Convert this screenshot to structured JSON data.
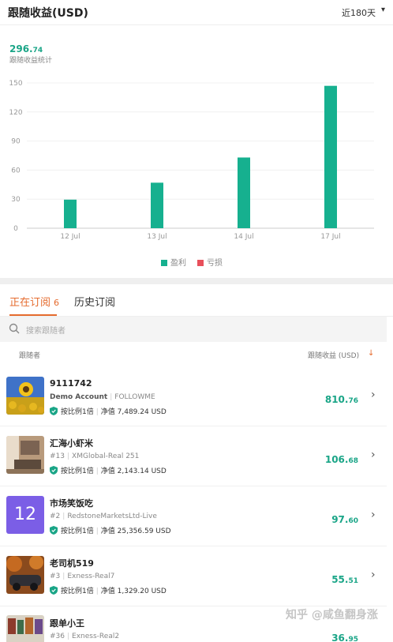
{
  "header": {
    "title": "跟随收益(USD)",
    "range": "近180天",
    "range_arrow": "▾"
  },
  "summary": {
    "total_int": "296.",
    "total_dec": "74",
    "label": "跟随收益统计"
  },
  "chart_data": {
    "type": "bar",
    "categories": [
      "12 Jul",
      "13 Jul",
      "14 Jul",
      "17 Jul"
    ],
    "series": [
      {
        "name": "盈利",
        "values": [
          29.5,
          47,
          73,
          147
        ],
        "color": "#16b08f"
      },
      {
        "name": "亏损",
        "values": [
          0,
          0,
          0,
          0
        ],
        "color": "#e8505b"
      }
    ],
    "yticks": [
      0,
      30,
      60,
      90,
      120,
      150
    ],
    "ylim": [
      0,
      150
    ],
    "grid": true,
    "legend_position": "bottom"
  },
  "tabs": [
    {
      "label": "正在订阅",
      "count": "6"
    },
    {
      "label": "历史订阅"
    }
  ],
  "search": {
    "placeholder": "搜索跟随者"
  },
  "columns": {
    "follower": "跟随者",
    "profit": "跟随收益 (USD)",
    "sort_icon": "↓"
  },
  "followers": [
    {
      "name": "9111742",
      "account": "Demo Account",
      "broker": "FOLLOWME",
      "ratio": "按比例1倍",
      "equity": "净值 7,489.24 USD",
      "profit_int": "810.",
      "profit_dec": "76",
      "avatar": "sunflower-photo"
    },
    {
      "name": "汇海小虾米",
      "account": "#13",
      "broker": "XMGlobal-Real 251",
      "ratio": "按比例1倍",
      "equity": "净值 2,143.14 USD",
      "profit_int": "106.",
      "profit_dec": "68",
      "avatar": "room-photo"
    },
    {
      "name": "市场笑饭吃",
      "account": "#2",
      "broker": "RedstoneMarketsLtd-Live",
      "ratio": "按比例1倍",
      "equity": "净值 25,356.59 USD",
      "profit_int": "97.",
      "profit_dec": "60",
      "avatar": "12",
      "avatar_color": "#7b5ee6"
    },
    {
      "name": "老司机519",
      "account": "#3",
      "broker": "Exness-Real7",
      "ratio": "按比例1倍",
      "equity": "净值 1,329.20 USD",
      "profit_int": "55.",
      "profit_dec": "51",
      "avatar": "car-photo"
    },
    {
      "name": "跟单小王",
      "account": "#36",
      "broker": "Exness-Real2",
      "ratio": "",
      "equity": "",
      "profit_int": "36.",
      "profit_dec": "95",
      "avatar": "shop-photo"
    }
  ],
  "watermark": "知乎 @咸鱼翻身涨"
}
